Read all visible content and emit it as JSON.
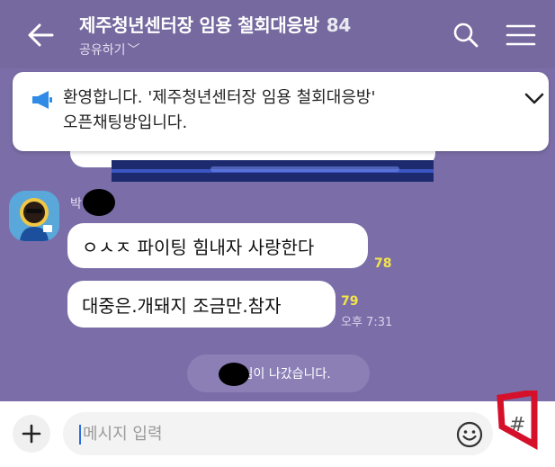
{
  "header": {
    "title": "제주청년센터장 임용 철회대응방",
    "member_count": "84",
    "share_label": "공유하기",
    "share_chevron": "﹀",
    "background": "#76699f"
  },
  "notice": {
    "line1": "환영합니다. '제주청년센터장 임용 철회대응방'",
    "line2": "오픈채팅방입니다."
  },
  "messages": {
    "sender_name": "박",
    "items": [
      {
        "text": "ㅇㅅㅈ 파이팅 힘내자 사랑한다",
        "unread": "78"
      },
      {
        "text": "대중은.개돼지 조금만.참자",
        "unread": "79",
        "time": "오후 7:31"
      }
    ],
    "system_notice": "박      님이 나갔습니다."
  },
  "composer": {
    "placeholder": "메시지 입력",
    "hash_label": "#"
  },
  "colors": {
    "chat_background": "#7b6ea8",
    "unread": "#f4e64a",
    "highlight": "#d4102a"
  },
  "icons": {
    "back": "back-arrow-icon",
    "search": "search-icon",
    "menu": "menu-icon",
    "megaphone": "megaphone-icon",
    "chevron": "chevron-down-icon",
    "plus": "plus-icon",
    "emoji": "emoji-icon"
  }
}
